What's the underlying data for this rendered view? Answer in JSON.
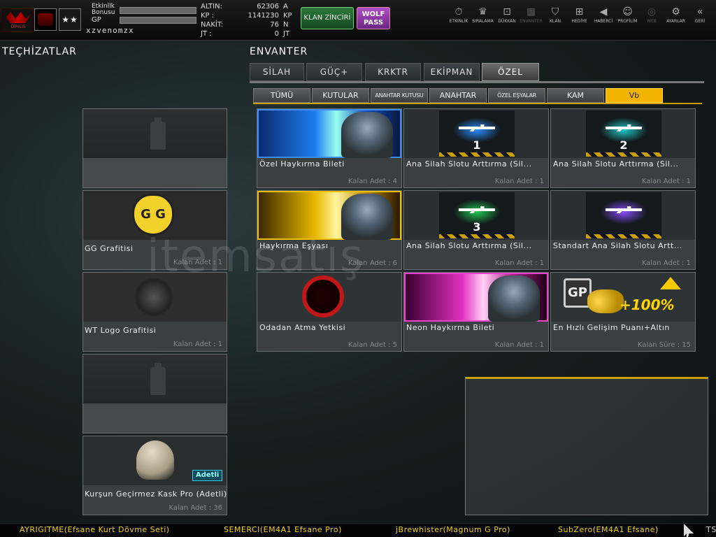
{
  "header": {
    "logo_caption": "DIRILIS",
    "rank_stars": "★★",
    "stat_labels": [
      "Etkinlik Bonusu",
      "GP"
    ],
    "username": "xzvenomzx",
    "currencies": [
      {
        "label": "ALTIN:",
        "value": "62306",
        "unit": "A"
      },
      {
        "label": "KP :",
        "value": "1141230",
        "unit": "KP"
      },
      {
        "label": "NAKİT:",
        "value": "76",
        "unit": "N"
      },
      {
        "label": "JT :",
        "value": "0",
        "unit": "JT"
      }
    ],
    "klan_button": "KLAN ZİNCİRİ",
    "wolf_pass_button": "WOLF PASS",
    "nav": [
      {
        "label": "ETKİNLİK",
        "icon": "⏱",
        "enabled": true
      },
      {
        "label": "SIRALAMA",
        "icon": "♛",
        "enabled": true
      },
      {
        "label": "DÜKKAN",
        "icon": "⊡",
        "enabled": true
      },
      {
        "label": "ENVANTER",
        "icon": "▦",
        "enabled": false
      },
      {
        "label": "KLAN",
        "icon": "⛉",
        "enabled": true
      },
      {
        "label": "HEDİYE",
        "icon": "⊞",
        "enabled": true
      },
      {
        "label": "HABERCİ",
        "icon": "◀",
        "enabled": true
      },
      {
        "label": "PROFİLİM",
        "icon": "☺",
        "enabled": true
      },
      {
        "label": "WEB",
        "icon": "◎",
        "enabled": false
      },
      {
        "label": "AYARLAR",
        "icon": "⚙",
        "enabled": true
      },
      {
        "label": "GERİ",
        "icon": "«",
        "enabled": true
      }
    ]
  },
  "equipment": {
    "title": "TEÇHİZATLAR",
    "slots": [
      {
        "name": "",
        "qty": "",
        "kind": "empty"
      },
      {
        "name": "GG Grafitisi",
        "qty": "Kalan Adet : 1",
        "kind": "gg"
      },
      {
        "name": "WT Logo Grafitisi",
        "qty": "Kalan Adet : 1",
        "kind": "wolf"
      },
      {
        "name": "",
        "qty": "",
        "kind": "empty"
      },
      {
        "name": "Kurşun Geçirmez Kask Pro (Adetli)",
        "qty": "Kalan Adet : 36",
        "kind": "helmet",
        "badge": "Adetli"
      }
    ],
    "gg_text": "G G"
  },
  "inventory": {
    "title": "ENVANTER",
    "tabs": [
      "SİLAH",
      "GÜÇ+",
      "KRKTR",
      "EKİPMAN",
      "ÖZEL"
    ],
    "active_tab": 4,
    "subtabs": [
      "TÜMÜ",
      "KUTULAR",
      "ANAHTAR KUTUSU",
      "ANAHTAR",
      "ÖZEL EŞYALAR",
      "KAM",
      "Vb"
    ],
    "active_subtab": 6,
    "items": [
      {
        "name": "Özel Haykırma Bileti",
        "qty": "Kalan Adet : 4",
        "kind": "blue"
      },
      {
        "name": "Ana Silah Slotu Arttırma (Sil...",
        "qty": "Kalan Adet : 1",
        "kind": "gun",
        "num": "1",
        "glow": "#2a8cff"
      },
      {
        "name": "Ana Silah Slotu Arttırma (Sil...",
        "qty": "Kalan Adet : 1",
        "kind": "gun",
        "num": "2",
        "glow": "#1ec8c8"
      },
      {
        "name": "Haykırma Eşyası",
        "qty": "Kalan Adet : 6",
        "kind": "yellow"
      },
      {
        "name": "Ana Silah Slotu Arttırma (Sil...",
        "qty": "Kalan Adet : 1",
        "kind": "gun",
        "num": "3",
        "glow": "#1ec850"
      },
      {
        "name": "Standart Ana Silah Slotu Artt...",
        "qty": "Kalan Adet : 1",
        "kind": "gun",
        "num": "",
        "glow": "#8a4cff"
      },
      {
        "name": "Odadan Atma Yetkisi",
        "qty": "Kalan Adet : 5",
        "kind": "kick"
      },
      {
        "name": "Neon Haykırma Bileti",
        "qty": "Kalan Adet : 1",
        "kind": "pink"
      },
      {
        "name": "En Hızlı Gelişim Puanı+Altın",
        "qty": "Kalan Süre : 15",
        "kind": "gp",
        "gp_label": "GP",
        "bonus": "+100%"
      }
    ]
  },
  "ticker": [
    "AYRIGITME(Efsane Kurt Dövme Seti)",
    "SEMERCI(EM4A1 Efsane Pro)",
    "jBrewhister(Magnum G Pro)",
    "SubZero(EM4A1 Efsane)",
    "TS"
  ],
  "watermark": "itemsatış"
}
